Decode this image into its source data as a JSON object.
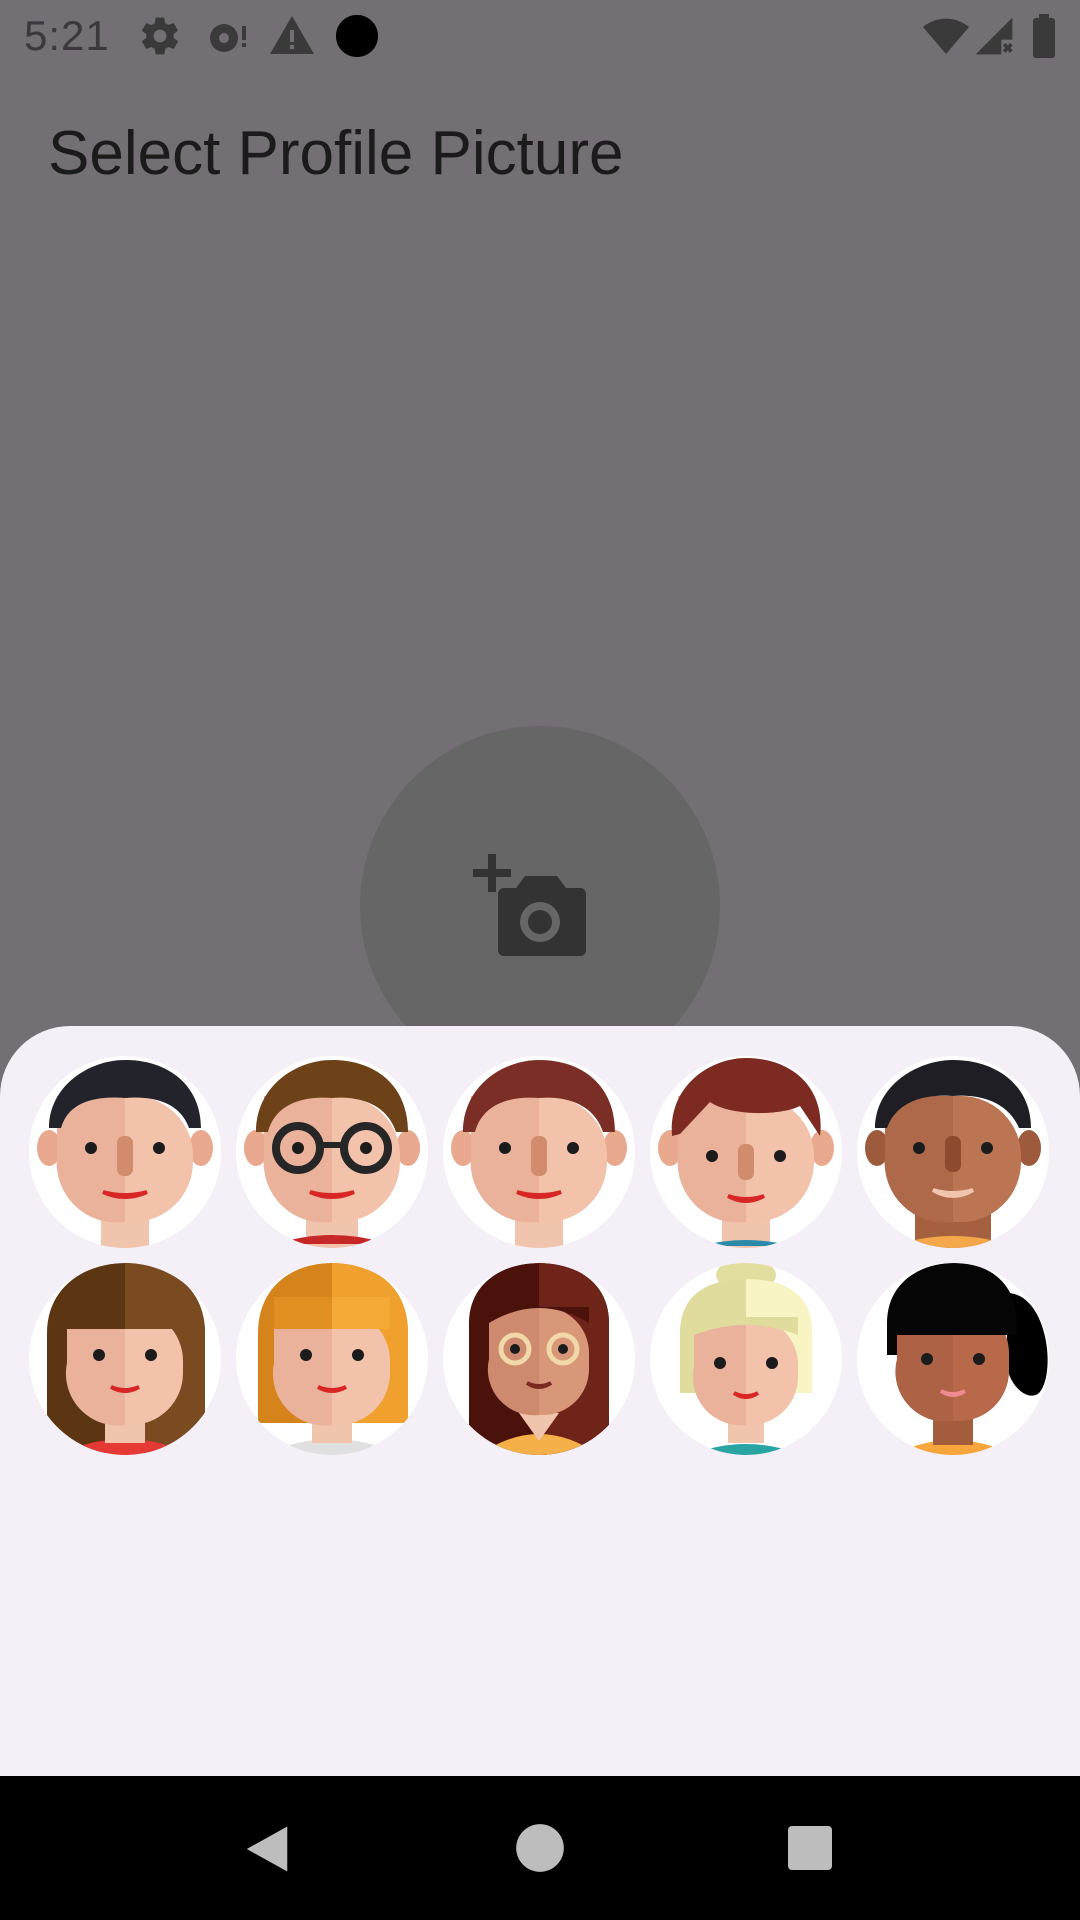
{
  "status_bar": {
    "time": "5:21",
    "left_icons": [
      "gear-icon",
      "sync-alert-icon",
      "warning-icon",
      "record-dot-icon"
    ],
    "right_icons": [
      "wifi-icon",
      "cellular-no-signal-icon",
      "battery-icon"
    ]
  },
  "page": {
    "title": "Select Profile Picture"
  },
  "camera_button": {
    "icon": "add-photo-camera-icon"
  },
  "avatar_picker": {
    "avatars": [
      {
        "id": "avatar-1",
        "description": "man-black-hair"
      },
      {
        "id": "avatar-2",
        "description": "man-brown-hair-glasses"
      },
      {
        "id": "avatar-3",
        "description": "man-auburn-hair"
      },
      {
        "id": "avatar-4",
        "description": "man-red-hair"
      },
      {
        "id": "avatar-5",
        "description": "man-dark-skin"
      },
      {
        "id": "avatar-6",
        "description": "woman-long-brown-hair"
      },
      {
        "id": "avatar-7",
        "description": "woman-orange-hair"
      },
      {
        "id": "avatar-8",
        "description": "woman-dark-hair-glasses"
      },
      {
        "id": "avatar-9",
        "description": "woman-blonde-bun"
      },
      {
        "id": "avatar-10",
        "description": "woman-black-ponytail"
      }
    ]
  },
  "nav_bar": {
    "buttons": [
      "back-icon",
      "home-icon",
      "recents-icon"
    ]
  },
  "colors": {
    "scrim": "#736f74",
    "sheet": "#f5eff8",
    "camera_circle": "#666666",
    "nav_bar": "#000000"
  }
}
